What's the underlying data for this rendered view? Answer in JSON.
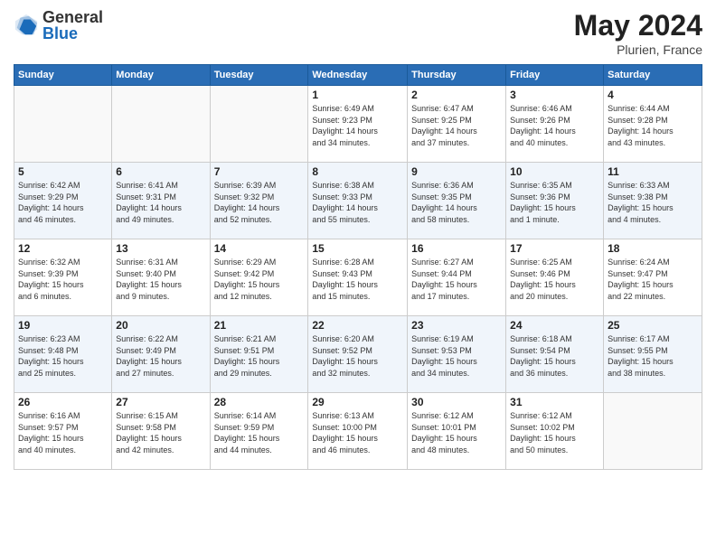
{
  "header": {
    "logo_general": "General",
    "logo_blue": "Blue",
    "main_title": "May 2024",
    "subtitle": "Plurien, France"
  },
  "days_of_week": [
    "Sunday",
    "Monday",
    "Tuesday",
    "Wednesday",
    "Thursday",
    "Friday",
    "Saturday"
  ],
  "weeks": [
    {
      "days": [
        {
          "num": "",
          "info": ""
        },
        {
          "num": "",
          "info": ""
        },
        {
          "num": "",
          "info": ""
        },
        {
          "num": "1",
          "info": "Sunrise: 6:49 AM\nSunset: 9:23 PM\nDaylight: 14 hours\nand 34 minutes."
        },
        {
          "num": "2",
          "info": "Sunrise: 6:47 AM\nSunset: 9:25 PM\nDaylight: 14 hours\nand 37 minutes."
        },
        {
          "num": "3",
          "info": "Sunrise: 6:46 AM\nSunset: 9:26 PM\nDaylight: 14 hours\nand 40 minutes."
        },
        {
          "num": "4",
          "info": "Sunrise: 6:44 AM\nSunset: 9:28 PM\nDaylight: 14 hours\nand 43 minutes."
        }
      ]
    },
    {
      "days": [
        {
          "num": "5",
          "info": "Sunrise: 6:42 AM\nSunset: 9:29 PM\nDaylight: 14 hours\nand 46 minutes."
        },
        {
          "num": "6",
          "info": "Sunrise: 6:41 AM\nSunset: 9:31 PM\nDaylight: 14 hours\nand 49 minutes."
        },
        {
          "num": "7",
          "info": "Sunrise: 6:39 AM\nSunset: 9:32 PM\nDaylight: 14 hours\nand 52 minutes."
        },
        {
          "num": "8",
          "info": "Sunrise: 6:38 AM\nSunset: 9:33 PM\nDaylight: 14 hours\nand 55 minutes."
        },
        {
          "num": "9",
          "info": "Sunrise: 6:36 AM\nSunset: 9:35 PM\nDaylight: 14 hours\nand 58 minutes."
        },
        {
          "num": "10",
          "info": "Sunrise: 6:35 AM\nSunset: 9:36 PM\nDaylight: 15 hours\nand 1 minute."
        },
        {
          "num": "11",
          "info": "Sunrise: 6:33 AM\nSunset: 9:38 PM\nDaylight: 15 hours\nand 4 minutes."
        }
      ]
    },
    {
      "days": [
        {
          "num": "12",
          "info": "Sunrise: 6:32 AM\nSunset: 9:39 PM\nDaylight: 15 hours\nand 6 minutes."
        },
        {
          "num": "13",
          "info": "Sunrise: 6:31 AM\nSunset: 9:40 PM\nDaylight: 15 hours\nand 9 minutes."
        },
        {
          "num": "14",
          "info": "Sunrise: 6:29 AM\nSunset: 9:42 PM\nDaylight: 15 hours\nand 12 minutes."
        },
        {
          "num": "15",
          "info": "Sunrise: 6:28 AM\nSunset: 9:43 PM\nDaylight: 15 hours\nand 15 minutes."
        },
        {
          "num": "16",
          "info": "Sunrise: 6:27 AM\nSunset: 9:44 PM\nDaylight: 15 hours\nand 17 minutes."
        },
        {
          "num": "17",
          "info": "Sunrise: 6:25 AM\nSunset: 9:46 PM\nDaylight: 15 hours\nand 20 minutes."
        },
        {
          "num": "18",
          "info": "Sunrise: 6:24 AM\nSunset: 9:47 PM\nDaylight: 15 hours\nand 22 minutes."
        }
      ]
    },
    {
      "days": [
        {
          "num": "19",
          "info": "Sunrise: 6:23 AM\nSunset: 9:48 PM\nDaylight: 15 hours\nand 25 minutes."
        },
        {
          "num": "20",
          "info": "Sunrise: 6:22 AM\nSunset: 9:49 PM\nDaylight: 15 hours\nand 27 minutes."
        },
        {
          "num": "21",
          "info": "Sunrise: 6:21 AM\nSunset: 9:51 PM\nDaylight: 15 hours\nand 29 minutes."
        },
        {
          "num": "22",
          "info": "Sunrise: 6:20 AM\nSunset: 9:52 PM\nDaylight: 15 hours\nand 32 minutes."
        },
        {
          "num": "23",
          "info": "Sunrise: 6:19 AM\nSunset: 9:53 PM\nDaylight: 15 hours\nand 34 minutes."
        },
        {
          "num": "24",
          "info": "Sunrise: 6:18 AM\nSunset: 9:54 PM\nDaylight: 15 hours\nand 36 minutes."
        },
        {
          "num": "25",
          "info": "Sunrise: 6:17 AM\nSunset: 9:55 PM\nDaylight: 15 hours\nand 38 minutes."
        }
      ]
    },
    {
      "days": [
        {
          "num": "26",
          "info": "Sunrise: 6:16 AM\nSunset: 9:57 PM\nDaylight: 15 hours\nand 40 minutes."
        },
        {
          "num": "27",
          "info": "Sunrise: 6:15 AM\nSunset: 9:58 PM\nDaylight: 15 hours\nand 42 minutes."
        },
        {
          "num": "28",
          "info": "Sunrise: 6:14 AM\nSunset: 9:59 PM\nDaylight: 15 hours\nand 44 minutes."
        },
        {
          "num": "29",
          "info": "Sunrise: 6:13 AM\nSunset: 10:00 PM\nDaylight: 15 hours\nand 46 minutes."
        },
        {
          "num": "30",
          "info": "Sunrise: 6:12 AM\nSunset: 10:01 PM\nDaylight: 15 hours\nand 48 minutes."
        },
        {
          "num": "31",
          "info": "Sunrise: 6:12 AM\nSunset: 10:02 PM\nDaylight: 15 hours\nand 50 minutes."
        },
        {
          "num": "",
          "info": ""
        }
      ]
    }
  ]
}
